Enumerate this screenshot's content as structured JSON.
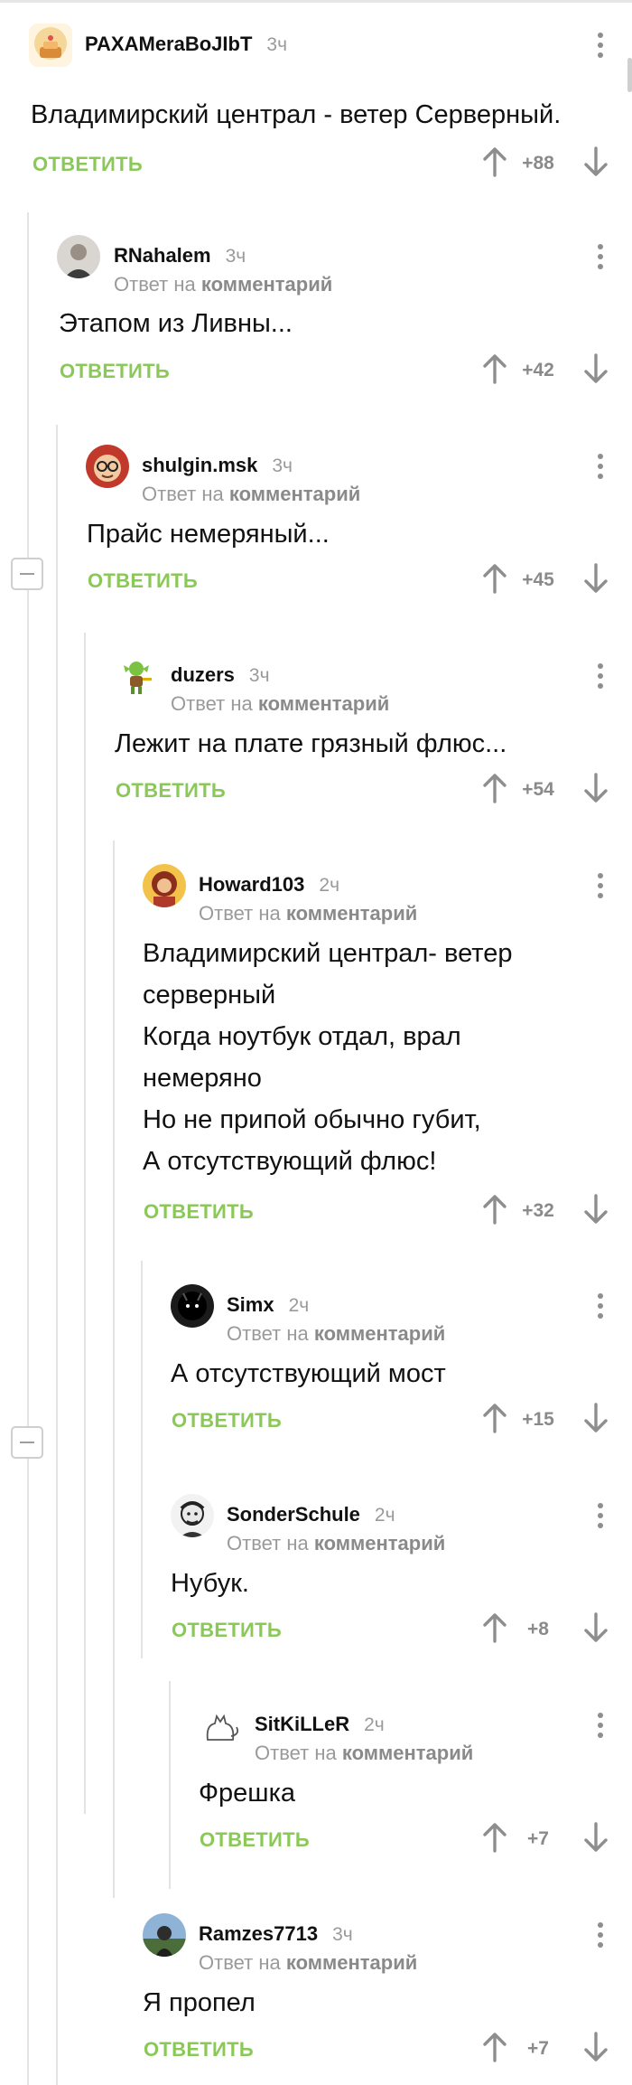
{
  "reply_label": "ОТВЕТИТЬ",
  "reply_to_prefix": "Ответ на",
  "reply_to_link": "комментарий",
  "comments": [
    {
      "username": "PAXAMeraBoJIbT",
      "time": "3ч",
      "text": "Владимирский централ - ветер Серверный.",
      "score": "+88"
    },
    {
      "username": "RNahalem",
      "time": "3ч",
      "text": "Этапом из Ливны...",
      "score": "+42"
    },
    {
      "username": "shulgin.msk",
      "time": "3ч",
      "text": "Прайс немеряный...",
      "score": "+45"
    },
    {
      "username": "duzers",
      "time": "3ч",
      "text": "Лежит на плате грязный флюс...",
      "score": "+54"
    },
    {
      "username": "Howard103",
      "time": "2ч",
      "text": "Владимирский централ- ветер\nсерверный\nКогда ноутбук отдал, врал\nнемеряно\nНо не припой обычно губит,\nА отсутствующий флюс!",
      "score": "+32"
    },
    {
      "username": "Simx",
      "time": "2ч",
      "text": "А отсутствующий мост",
      "score": "+15"
    },
    {
      "username": "SonderSchule",
      "time": "2ч",
      "text": "Нубук.",
      "score": "+8"
    },
    {
      "username": "SitKiLLeR",
      "time": "2ч",
      "text": "Фрешка",
      "score": "+7"
    },
    {
      "username": "Ramzes7713",
      "time": "3ч",
      "text": "Я пропел",
      "score": "+7"
    }
  ]
}
